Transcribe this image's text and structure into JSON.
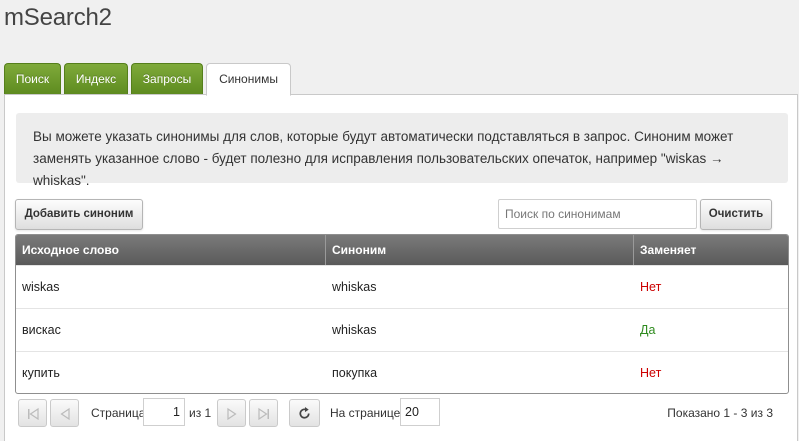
{
  "page": {
    "title": "mSearch2"
  },
  "tabs": [
    {
      "label": "Поиск",
      "active": false
    },
    {
      "label": "Индекс",
      "active": false
    },
    {
      "label": "Запросы",
      "active": false
    },
    {
      "label": "Синонимы",
      "active": true
    }
  ],
  "info": {
    "text": "Вы можете указать синонимы для слов, которые будут автоматически подставляться в запрос. Синоним может заменять указанное слово - будет полезно для исправления пользовательских опечаток, например \"wiskas → whiskas\"."
  },
  "toolbar": {
    "add_label": "Добавить синоним",
    "search_placeholder": "Поиск по синонимам",
    "search_value": "",
    "clear_label": "Очистить"
  },
  "grid": {
    "columns": [
      "Исходное слово",
      "Синоним",
      "Заменяет"
    ],
    "rows": [
      {
        "source": "wiskas",
        "synonym": "whiskas",
        "replaces": "Нет"
      },
      {
        "source": "вискас",
        "synonym": "whiskas",
        "replaces": "Да"
      },
      {
        "source": "купить",
        "synonym": "покупка",
        "replaces": "Нет"
      }
    ]
  },
  "pager": {
    "page_label": "Страница",
    "page_value": "1",
    "of_label": "из 1",
    "per_page_label": "На странице:",
    "per_page_value": "20",
    "summary": "Показано 1 - 3 из 3"
  },
  "colors": {
    "tab_green": "#6b9a2b",
    "no": "#cc0000",
    "yes": "#2e8b1e",
    "grid_header": "#6a6a6a"
  }
}
